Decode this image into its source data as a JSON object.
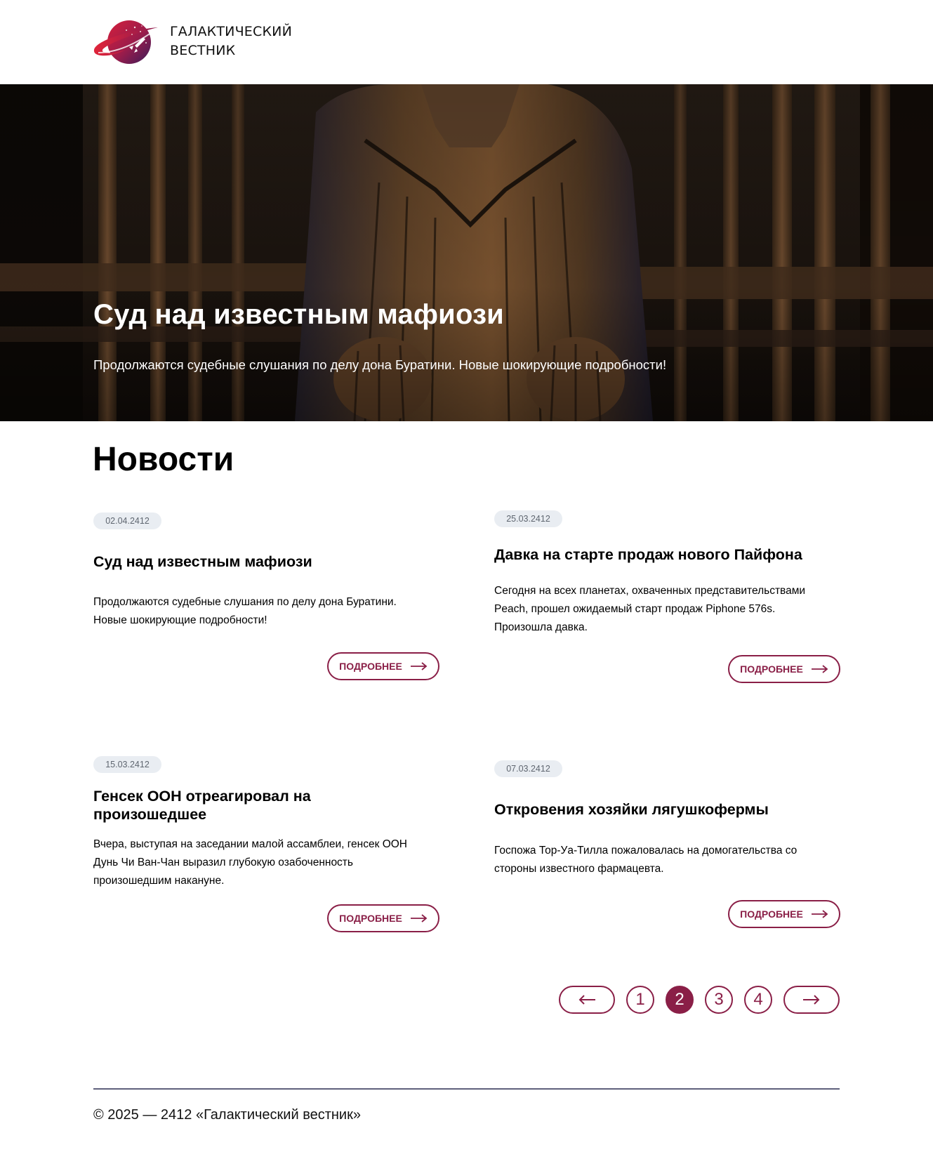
{
  "site": {
    "title_line1": "ГАЛАКТИЧЕСКИЙ",
    "title_line2": "ВЕСТНИК"
  },
  "colors": {
    "accent": "#8a1f47",
    "badge_bg": "#e9edf2",
    "footer_line": "#5f607c"
  },
  "hero": {
    "title": "Суд над известным мафиози",
    "description": "Продолжаются судебные слушания по делу дона Буратини. Новые шокирующие подробности!"
  },
  "news": {
    "section_title": "Новости",
    "more_label": "Подробнее",
    "items": [
      {
        "date": "02.04.2412",
        "title": "Суд над известным мафиози",
        "text": "Продолжаются судебные слушания по делу дона Буратини. Новые шокирующие подробности!"
      },
      {
        "date": "25.03.2412",
        "title": "Давка на старте продаж нового Пайфона",
        "text": "Сегодня на всех планетах, охваченных представительствами Peach, прошел ожидаемый старт продаж Piphone 576s. Произошла давка."
      },
      {
        "date": "15.03.2412",
        "title": "Генсек ООН отреагировал на произошедшее",
        "text": "Вчера, выступая на заседании малой ассамблеи, генсек ООН Дунь Чи Ван-Чан выразил глубокую озабоченность произошедшим накануне."
      },
      {
        "date": "07.03.2412",
        "title": "Откровения хозяйки лягушкофермы",
        "text": "Госпожа Тор-Уа-Тилла пожаловалась на домогательства со стороны известного фармацевта."
      }
    ]
  },
  "pagination": {
    "pages": [
      "1",
      "2",
      "3",
      "4"
    ],
    "current": "2",
    "prev_icon": "arrow-left-icon",
    "next_icon": "arrow-right-icon"
  },
  "footer": {
    "copyright": "© 2025 — 2412 «Галактический вестник»"
  }
}
